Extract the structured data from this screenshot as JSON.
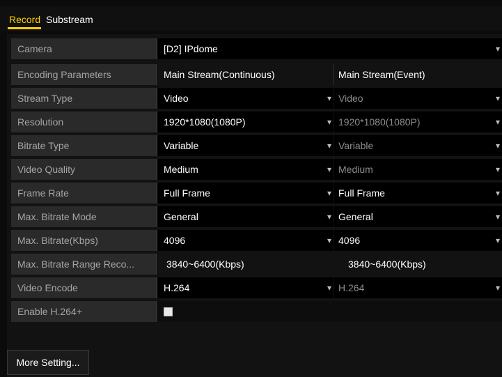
{
  "tabs": [
    {
      "label": "Record"
    },
    {
      "label": "Substream"
    }
  ],
  "camera": {
    "label": "Camera",
    "value": "[D2] IPdome"
  },
  "header": {
    "label": "Encoding Parameters",
    "col1": "Main Stream(Continuous)",
    "col2": "Main Stream(Event)"
  },
  "rows": [
    {
      "label": "Stream Type",
      "v1": "Video",
      "v2": "Video"
    },
    {
      "label": "Resolution",
      "v1": "1920*1080(1080P)",
      "v2": "1920*1080(1080P)"
    },
    {
      "label": "Bitrate Type",
      "v1": "Variable",
      "v2": "Variable"
    },
    {
      "label": "Video Quality",
      "v1": "Medium",
      "v2": "Medium"
    },
    {
      "label": "Frame Rate",
      "v1": "Full Frame",
      "v2": "Full Frame"
    },
    {
      "label": "Max. Bitrate Mode",
      "v1": "General",
      "v2": "General"
    },
    {
      "label": "Max. Bitrate(Kbps)",
      "v1": "4096",
      "v2": "4096"
    },
    {
      "label": "Max. Bitrate Range Reco...",
      "v1": "3840~6400(Kbps)",
      "v2": "3840~6400(Kbps)"
    },
    {
      "label": "Video Encode",
      "v1": "H.264",
      "v2": "H.264"
    }
  ],
  "h264plus": {
    "label": "Enable H.264+",
    "checked": false
  },
  "buttons": {
    "more_setting": "More Setting..."
  },
  "icons": {
    "dropdown": "▾"
  },
  "colors": {
    "accent": "#ffd200",
    "label_bg": "#2a2a2a",
    "value_bg": "#000000",
    "disabled_text": "#8c8c8c"
  }
}
